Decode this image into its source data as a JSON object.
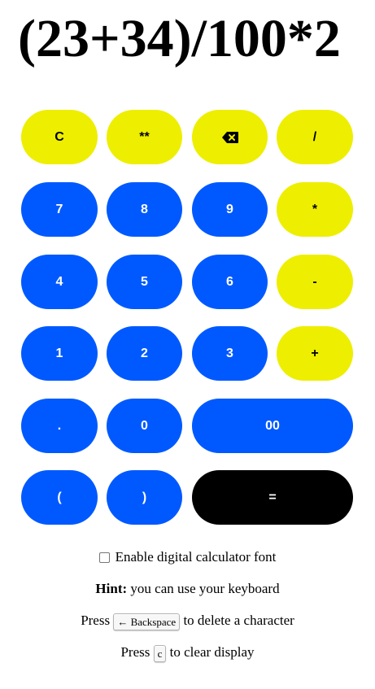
{
  "display": {
    "expression": "(23+34)/100*2"
  },
  "keys": {
    "clear": "C",
    "power": "**",
    "backspace_icon": "backspace-icon",
    "divide": "/",
    "seven": "7",
    "eight": "8",
    "nine": "9",
    "multiply": "*",
    "four": "4",
    "five": "5",
    "six": "6",
    "subtract": "-",
    "one": "1",
    "two": "2",
    "three": "3",
    "add": "+",
    "decimal": ".",
    "zero": "0",
    "double_zero": "00",
    "open_paren": "(",
    "close_paren": ")",
    "equals": "="
  },
  "colors": {
    "operator_yellow": "#eeee00",
    "digit_blue": "#0059ff",
    "equals_black": "#000000"
  },
  "options": {
    "digital_font_label": "Enable digital calculator font",
    "digital_font_checked": false
  },
  "hints": {
    "hint_label": "Hint:",
    "hint_text": " you can use your keyboard",
    "backspace_prefix": "Press ",
    "backspace_key": "← Backspace",
    "backspace_suffix": " to delete a character",
    "clear_prefix": "Press ",
    "clear_key": "c",
    "clear_suffix": " to clear display"
  }
}
